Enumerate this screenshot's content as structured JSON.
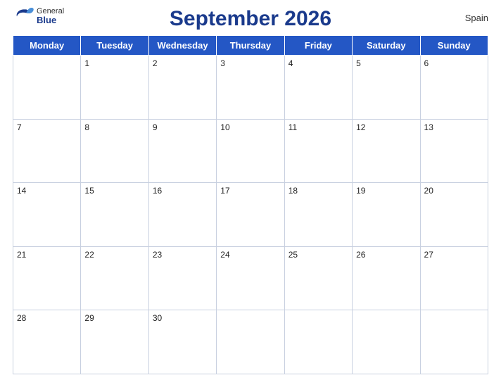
{
  "header": {
    "logo_general": "General",
    "logo_blue": "Blue",
    "title": "September 2026",
    "country": "Spain"
  },
  "days_of_week": [
    "Monday",
    "Tuesday",
    "Wednesday",
    "Thursday",
    "Friday",
    "Saturday",
    "Sunday"
  ],
  "weeks": [
    [
      "",
      "1",
      "2",
      "3",
      "4",
      "5",
      "6"
    ],
    [
      "7",
      "8",
      "9",
      "10",
      "11",
      "12",
      "13"
    ],
    [
      "14",
      "15",
      "16",
      "17",
      "18",
      "19",
      "20"
    ],
    [
      "21",
      "22",
      "23",
      "24",
      "25",
      "26",
      "27"
    ],
    [
      "28",
      "29",
      "30",
      "",
      "",
      "",
      ""
    ]
  ]
}
